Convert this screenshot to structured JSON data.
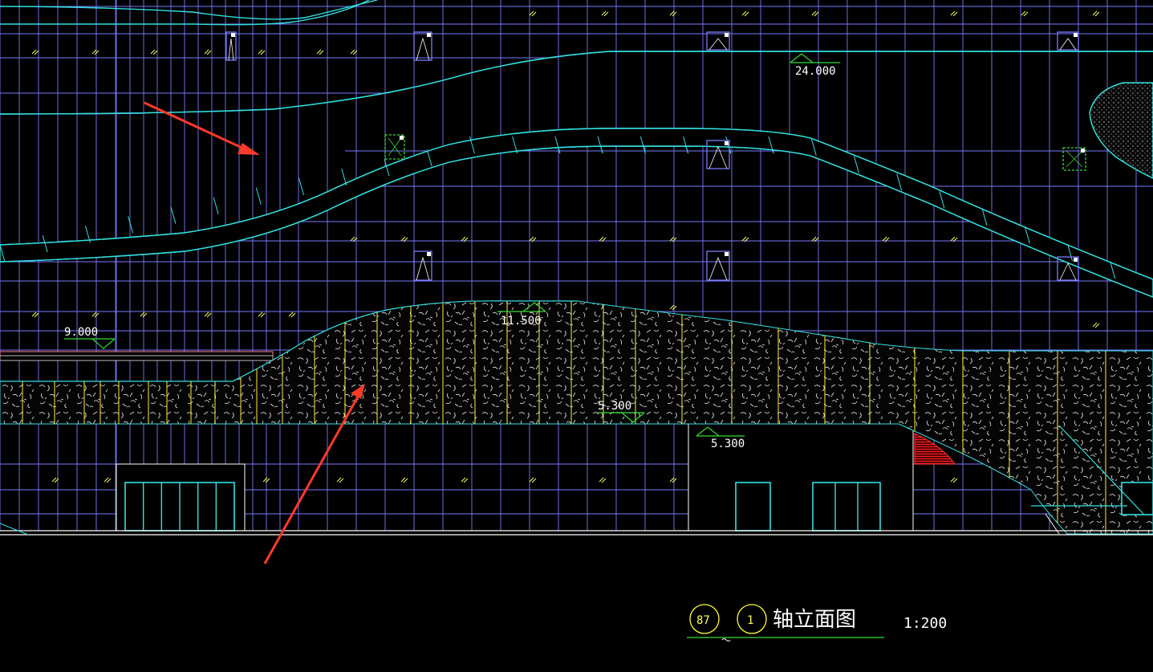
{
  "drawing": {
    "title_label": "轴立面图",
    "scale_label": "1:200",
    "bubble_left": "87",
    "bubble_right": "1"
  },
  "elevations": [
    {
      "label": "24.000"
    },
    {
      "label": "11.500"
    },
    {
      "label": "9.000"
    },
    {
      "label": "5.300"
    },
    {
      "label": "5.300"
    }
  ],
  "colors": {
    "background": "#000000",
    "grid": "#7a7aff",
    "curve": "#33e0e0",
    "marker": "#33dd33",
    "hatch_fill": "#0a0a0a",
    "mullion": "#ffee33",
    "arrow": "#ff3a2a",
    "red_hatch": "#cc1111",
    "text": "#ffffff"
  }
}
